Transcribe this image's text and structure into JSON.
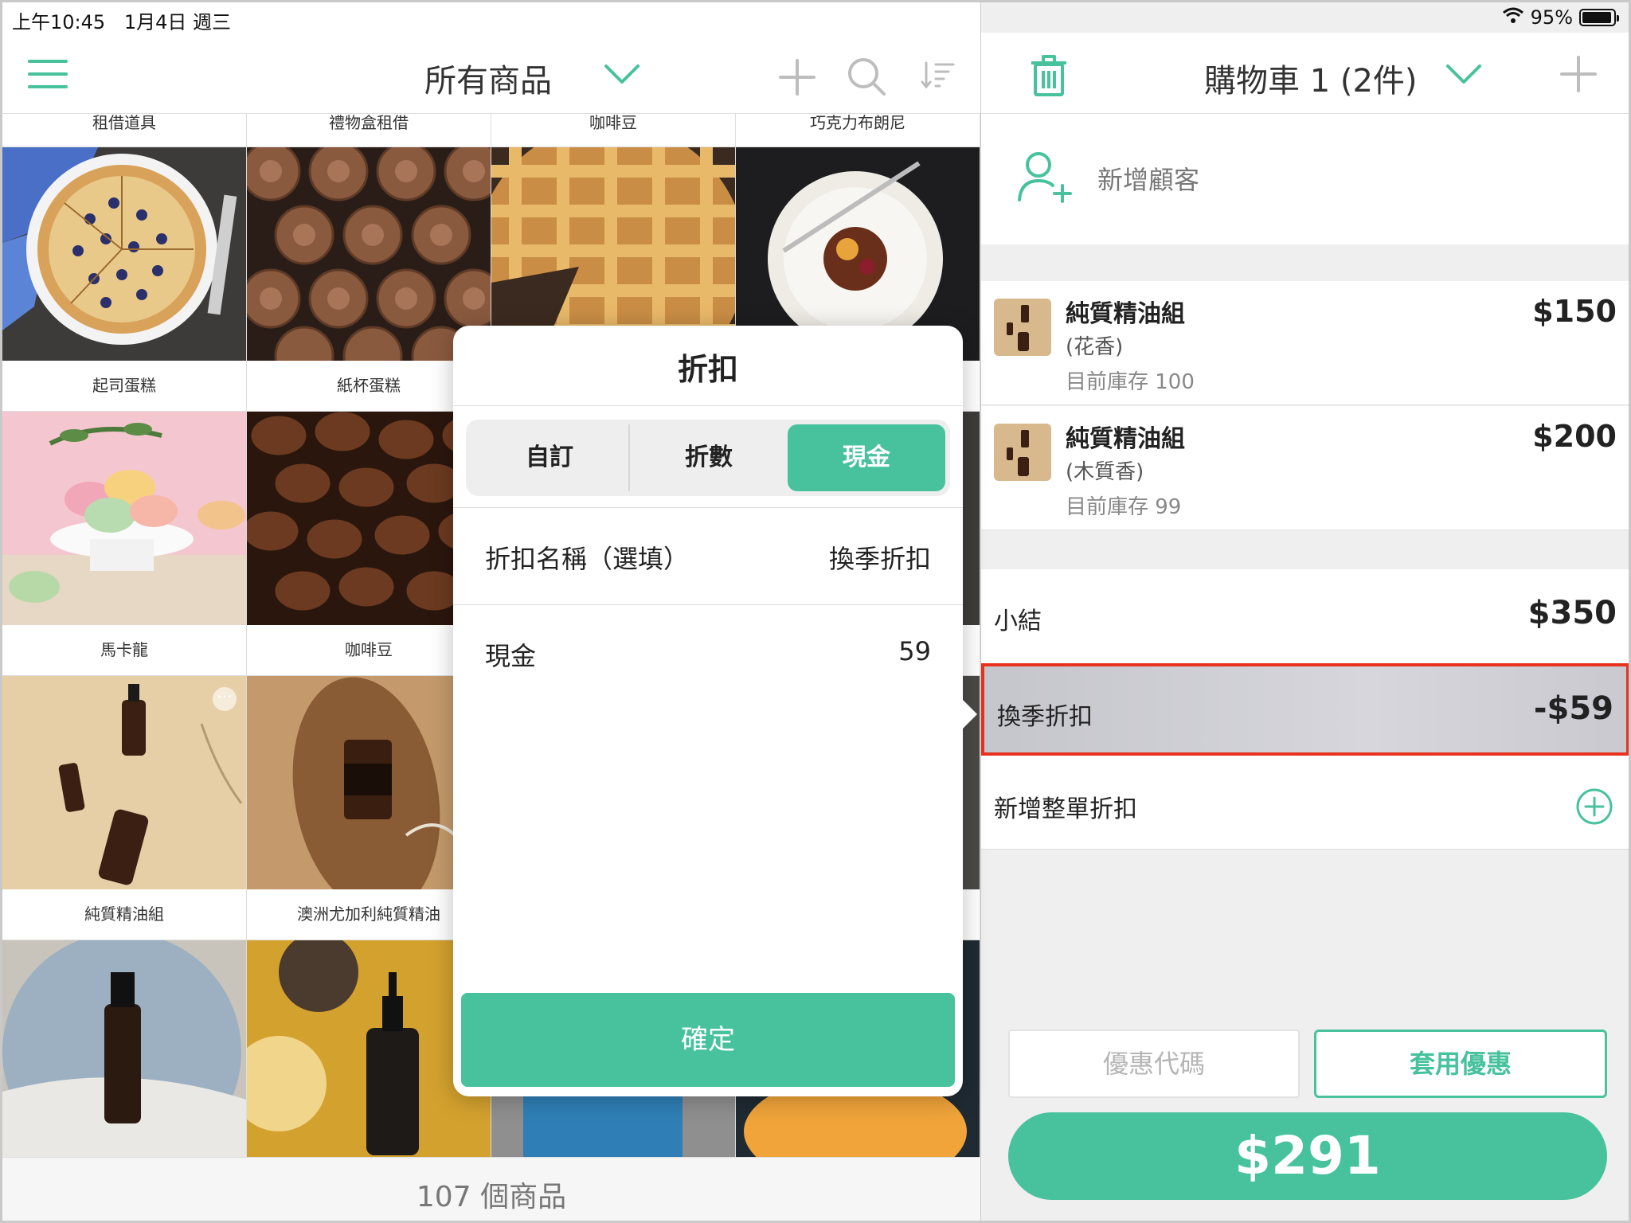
{
  "status_bar": {
    "time": "上午10:45",
    "date": "1月4日 週三",
    "battery_text": "95%",
    "battery_level": 0.95
  },
  "left_nav": {
    "title": "所有商品"
  },
  "product_grid": {
    "top_row_labels": [
      "租借道具",
      "禮物盒租借",
      "咖啡豆",
      "巧克力布朗尼"
    ],
    "items": [
      {
        "label": "起司蛋糕"
      },
      {
        "label": "紙杯蛋糕"
      },
      {
        "label": ""
      },
      {
        "label": ""
      },
      {
        "label": "馬卡龍"
      },
      {
        "label": "咖啡豆"
      },
      {
        "label": ""
      },
      {
        "label": ""
      },
      {
        "label": "純質精油組"
      },
      {
        "label": "澳洲尤加利純質精油"
      },
      {
        "label": ""
      },
      {
        "label": ""
      }
    ],
    "more_icon": "⋯"
  },
  "bottom_bar": {
    "count_text": "107 個商品"
  },
  "discount_popover": {
    "title": "折扣",
    "tabs": [
      {
        "label": "自訂"
      },
      {
        "label": "折數"
      },
      {
        "label": "現金"
      }
    ],
    "active_tab": "現金",
    "name_row": {
      "label": "折扣名稱（選填）",
      "value": "換季折扣"
    },
    "amount_row": {
      "label": "現金",
      "value": "59"
    },
    "confirm_label": "確定"
  },
  "cart": {
    "title": "購物車 1 (2件)",
    "add_customer_label": "新增顧客",
    "items": [
      {
        "name": "純質精油組",
        "variant": "(花香)",
        "stock": "目前庫存 100",
        "price": "$150"
      },
      {
        "name": "純質精油組",
        "variant": "(木質香)",
        "stock": "目前庫存 99",
        "price": "$200"
      }
    ],
    "subtotal": {
      "label": "小結",
      "value": "$350"
    },
    "discount": {
      "label": "換季折扣",
      "value": "-$59"
    },
    "add_order_discount_label": "新增整單折扣",
    "promo_placeholder": "優惠代碼",
    "apply_label": "套用優惠",
    "total": "$291"
  },
  "colors": {
    "accent": "#47c29d",
    "highlight_border": "#e8321f"
  }
}
